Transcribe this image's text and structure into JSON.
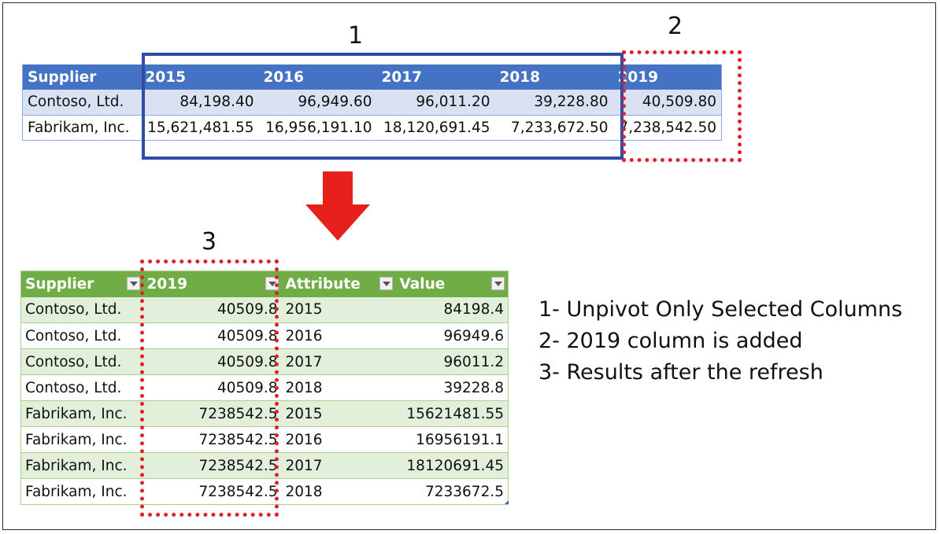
{
  "labels": {
    "one": "1",
    "two": "2",
    "three": "3"
  },
  "top_table": {
    "headers": [
      "Supplier",
      "2015",
      "2016",
      "2017",
      "2018",
      "2019"
    ],
    "rows": [
      [
        "Contoso, Ltd.",
        "84,198.40",
        "96,949.60",
        "96,011.20",
        "39,228.80",
        "40,509.80"
      ],
      [
        "Fabrikam, Inc.",
        "15,621,481.55",
        "16,956,191.10",
        "18,120,691.45",
        "7,233,672.50",
        "7,238,542.50"
      ]
    ]
  },
  "bottom_table": {
    "headers": [
      "Supplier",
      "2019",
      "Attribute",
      "Value"
    ],
    "rows": [
      [
        "Contoso, Ltd.",
        "40509.8",
        "2015",
        "84198.4"
      ],
      [
        "Contoso, Ltd.",
        "40509.8",
        "2016",
        "96949.6"
      ],
      [
        "Contoso, Ltd.",
        "40509.8",
        "2017",
        "96011.2"
      ],
      [
        "Contoso, Ltd.",
        "40509.8",
        "2018",
        "39228.8"
      ],
      [
        "Fabrikam, Inc.",
        "7238542.5",
        "2015",
        "15621481.55"
      ],
      [
        "Fabrikam, Inc.",
        "7238542.5",
        "2016",
        "16956191.1"
      ],
      [
        "Fabrikam, Inc.",
        "7238542.5",
        "2017",
        "18120691.45"
      ],
      [
        "Fabrikam, Inc.",
        "7238542.5",
        "2018",
        "7233672.5"
      ]
    ]
  },
  "notes": [
    "1- Unpivot Only Selected Columns",
    "2- 2019  column is added",
    "3- Results after the refresh"
  ],
  "colors": {
    "top_header": "#4472c4",
    "bottom_header": "#70ad47",
    "highlight_solid": "#2e4ea6",
    "highlight_dotted": "#e0202a",
    "arrow": "#e8201c"
  }
}
